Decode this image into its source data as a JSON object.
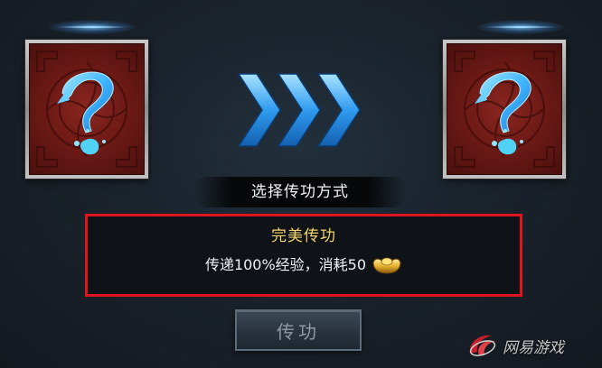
{
  "panel": {
    "title": "选择传功方式"
  },
  "method": {
    "name": "完美传功",
    "description": "传递100%经验，消耗50"
  },
  "confirm_button": {
    "label": "传功"
  },
  "watermark": {
    "text": "网易游戏"
  },
  "slots": {
    "source": {
      "icon": "question-mark-icon"
    },
    "target": {
      "icon": "question-mark-icon"
    }
  },
  "colors": {
    "highlight_border": "#e0141f",
    "method_name": "#f2d36a",
    "arrow_blue": "#3fb4ff",
    "slot_red": "#7a1e19"
  }
}
